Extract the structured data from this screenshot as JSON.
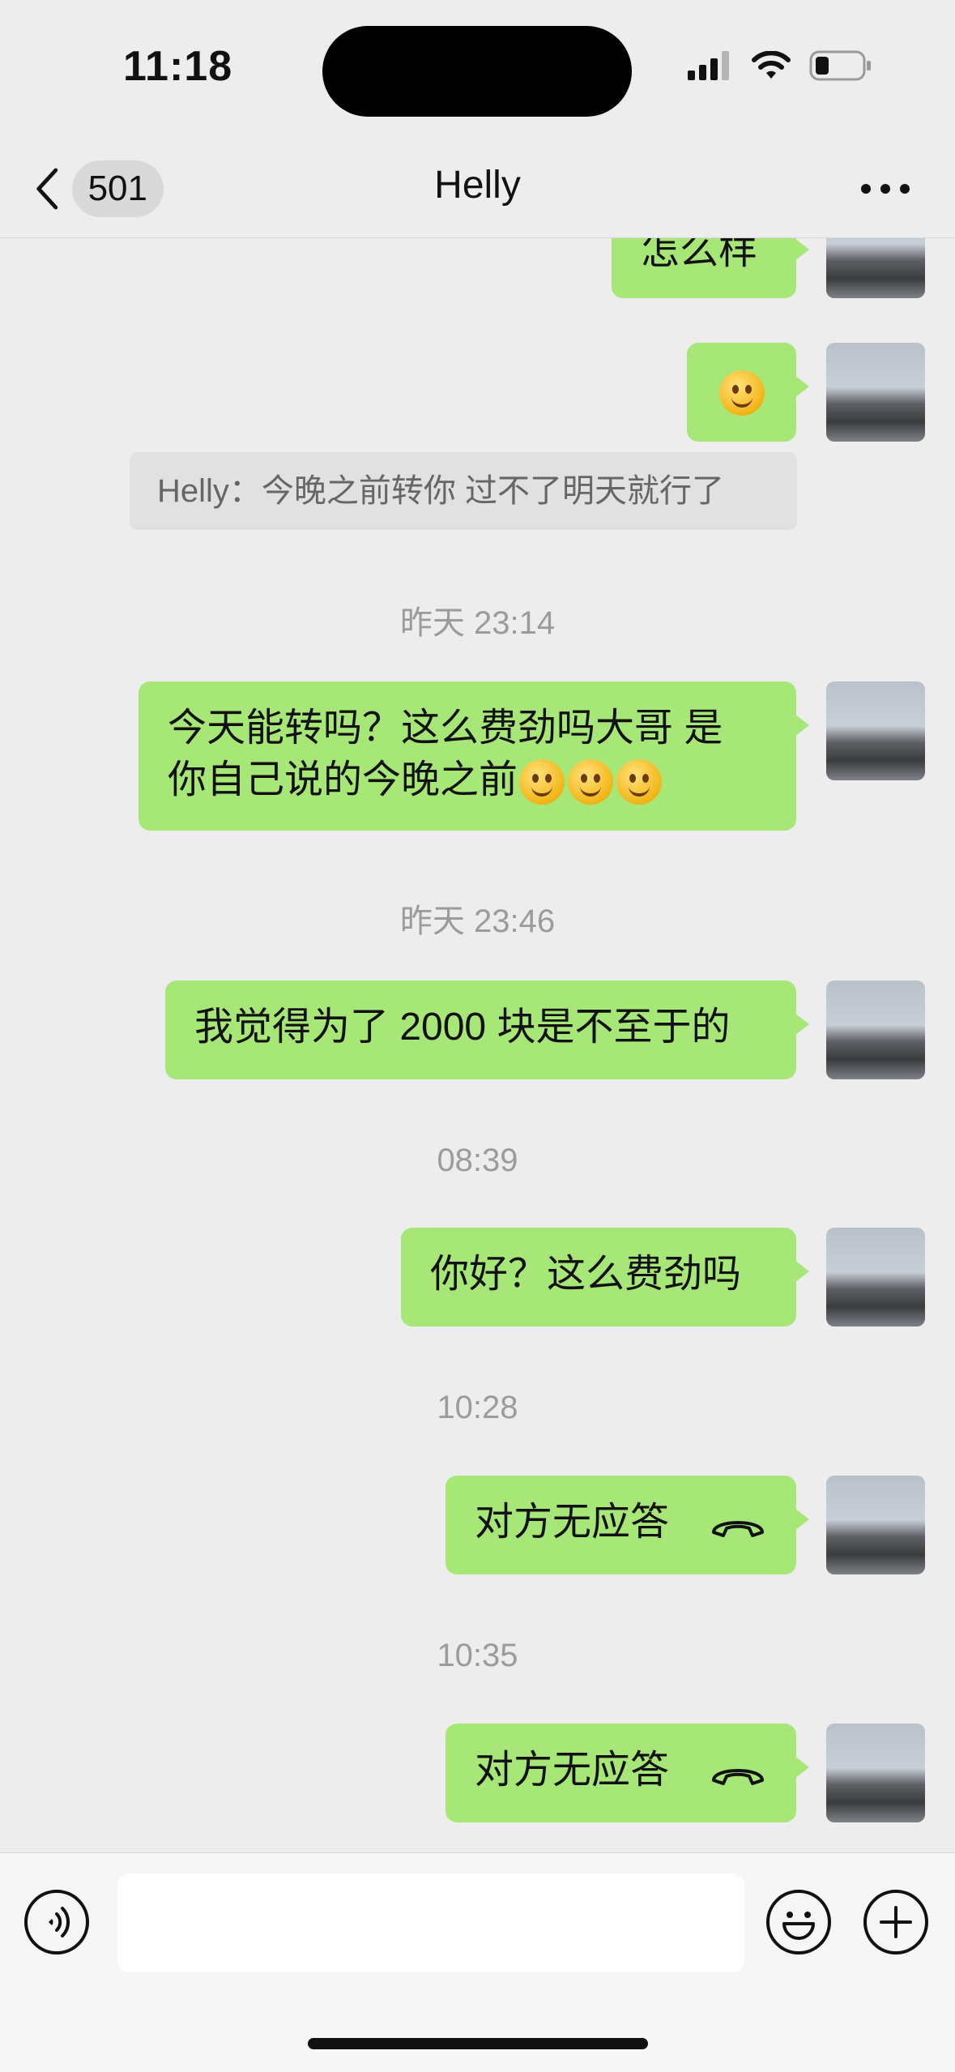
{
  "status_bar": {
    "time": "11:18"
  },
  "nav": {
    "back_count": "501",
    "title": "Helly"
  },
  "messages": {
    "m1": "怎么样",
    "recall": "Helly：今晚之前转你 过不了明天就行了",
    "ts1": "昨天 23:14",
    "m3_line1": "今天能转吗？这么费劲吗大哥 是",
    "m3_line2": "你自己说的今晚之前",
    "ts2": "昨天 23:46",
    "m4": "我觉得为了 2000 块是不至于的",
    "ts3": "08:39",
    "m5": "你好？这么费劲吗",
    "ts4": "10:28",
    "call1": "对方无应答",
    "ts5": "10:35",
    "call2": "对方无应答"
  },
  "colors": {
    "bubble_green": "#a6e777",
    "background": "#ededed"
  },
  "icons": [
    "back-chevron-icon",
    "more-dots-icon",
    "voice-icon",
    "emoji-icon",
    "plus-icon",
    "phone-hangup-icon",
    "smile-emoji"
  ]
}
